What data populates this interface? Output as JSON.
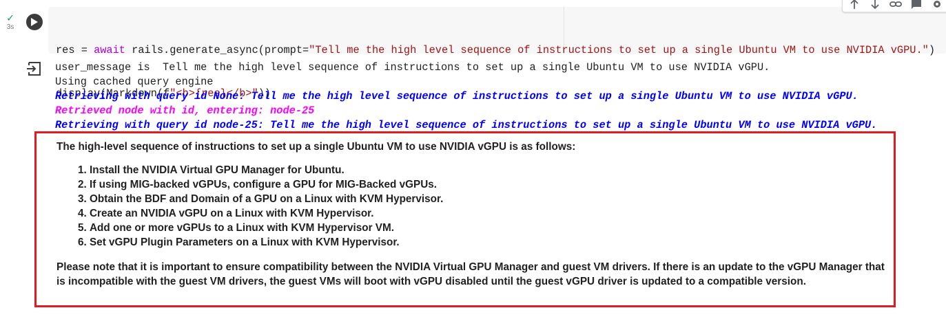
{
  "cell": {
    "status_check": "✓",
    "exec_time": "3s",
    "code": {
      "line1_tokens": [
        {
          "text": "res = ",
          "cls": "plain"
        },
        {
          "text": "await",
          "cls": "kw"
        },
        {
          "text": " rails.generate_async(prompt=",
          "cls": "plain"
        },
        {
          "text": "\"Tell me the high level sequence of instructions to set up a single Ubuntu VM to use NVIDIA vGPU.\"",
          "cls": "str"
        },
        {
          "text": ")",
          "cls": "plain"
        }
      ],
      "line2_tokens": [
        {
          "text": "display(Markdown(f",
          "cls": "plain"
        },
        {
          "text": "\"<b>{res}</b>\"",
          "cls": "str"
        },
        {
          "text": "))",
          "cls": "plain"
        }
      ]
    }
  },
  "toolbar": {
    "icons": [
      "arrow-up-icon",
      "arrow-down-icon",
      "link-icon",
      "comment-icon",
      "gear-icon"
    ]
  },
  "output": {
    "lines": [
      {
        "text": "user_message is  Tell me the high level sequence of instructions to set up a single Ubuntu VM to use NVIDIA vGPU.",
        "style": "plain"
      },
      {
        "text": "Using cached query engine",
        "style": "plain"
      },
      {
        "text": "Retrieving with query id None: Tell me the high level sequence of instructions to set up a single Ubuntu VM to use NVIDIA vGPU.",
        "style": "blue"
      },
      {
        "text": "Retrieved node with id, entering: node-25",
        "style": "magenta"
      },
      {
        "text": "Retrieving with query id node-25: Tell me the high level sequence of instructions to set up a single Ubuntu VM to use NVIDIA vGPU.",
        "style": "blue"
      }
    ]
  },
  "answer": {
    "intro": "The high-level sequence of instructions to set up a single Ubuntu VM to use NVIDIA vGPU is as follows:",
    "steps": [
      "Install the NVIDIA Virtual GPU Manager for Ubuntu.",
      "If using MIG-backed vGPUs, configure a GPU for MIG-Backed vGPUs.",
      "Obtain the BDF and Domain of a GPU on a Linux with KVM Hypervisor.",
      "Create an NVIDIA vGPU on a Linux with KVM Hypervisor.",
      "Add one or more vGPUs to a Linux with KVM Hypervisor VM.",
      "Set vGPU Plugin Parameters on a Linux with KVM Hypervisor."
    ],
    "note": "Please note that it is important to ensure compatibility between the NVIDIA Virtual GPU Manager and guest VM drivers. If there is an update to the vGPU Manager that is incompatible with the guest VM drivers, the guest VMs will boot with vGPU disabled until the guest vGPU driver is updated to a compatible version."
  },
  "colors": {
    "highlight_border": "#e01b24",
    "log_blue": "#0000ff",
    "log_magenta": "#ff00ff"
  }
}
